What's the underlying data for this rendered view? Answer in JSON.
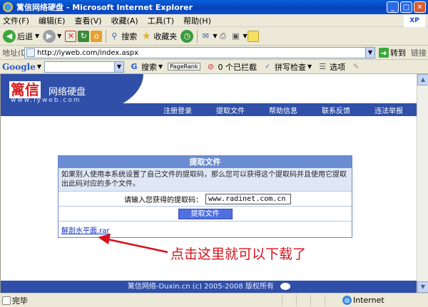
{
  "window": {
    "title": "篱信网络硬盘 - Microsoft Internet Explorer"
  },
  "menu": [
    "文件(F)",
    "编辑(E)",
    "查看(V)",
    "收藏(A)",
    "工具(T)",
    "帮助(H)"
  ],
  "toolbar": {
    "back": "后退",
    "search": "搜索",
    "favorites": "收藏夹"
  },
  "address": {
    "label": "地址(D)",
    "url": "http://iyweb.com/index.aspx",
    "go": "转到",
    "links": "链接"
  },
  "google": {
    "brand": "Google",
    "search": "搜索",
    "pagerank": "PageRank",
    "blocked": "0 个已拦截",
    "spellcheck": "拼写检查",
    "options": "选项"
  },
  "site": {
    "logo_main": "篱信",
    "logo_sub": "网络硬盘",
    "logo_url": "www.iyweb.com",
    "nav": [
      "注册登录",
      "提取文件",
      "帮助信息",
      "联系反馈",
      "违法举报"
    ],
    "panel": {
      "title": "提取文件",
      "desc": "如果别人使用本系统设置了自己文件的提取码，那么您可以获得这个提取码并且使用它提取出此码对应的多个文件。",
      "input_label": "请输入您获得的提取码：",
      "input_value": "www.radinet.com.cn",
      "button": "提取文件",
      "link": "解剖水平面.rar"
    },
    "annotation": "点击这里就可以下载了",
    "footer": "篱信网络-Duxin.cn (c) 2005-2008 版权所有"
  },
  "status": {
    "text": "完毕",
    "zone": "Internet"
  },
  "colors": {
    "nav_blue": "#2f4fa8",
    "panel_header": "#6a8cd2",
    "annotation_red": "#d8101a"
  }
}
